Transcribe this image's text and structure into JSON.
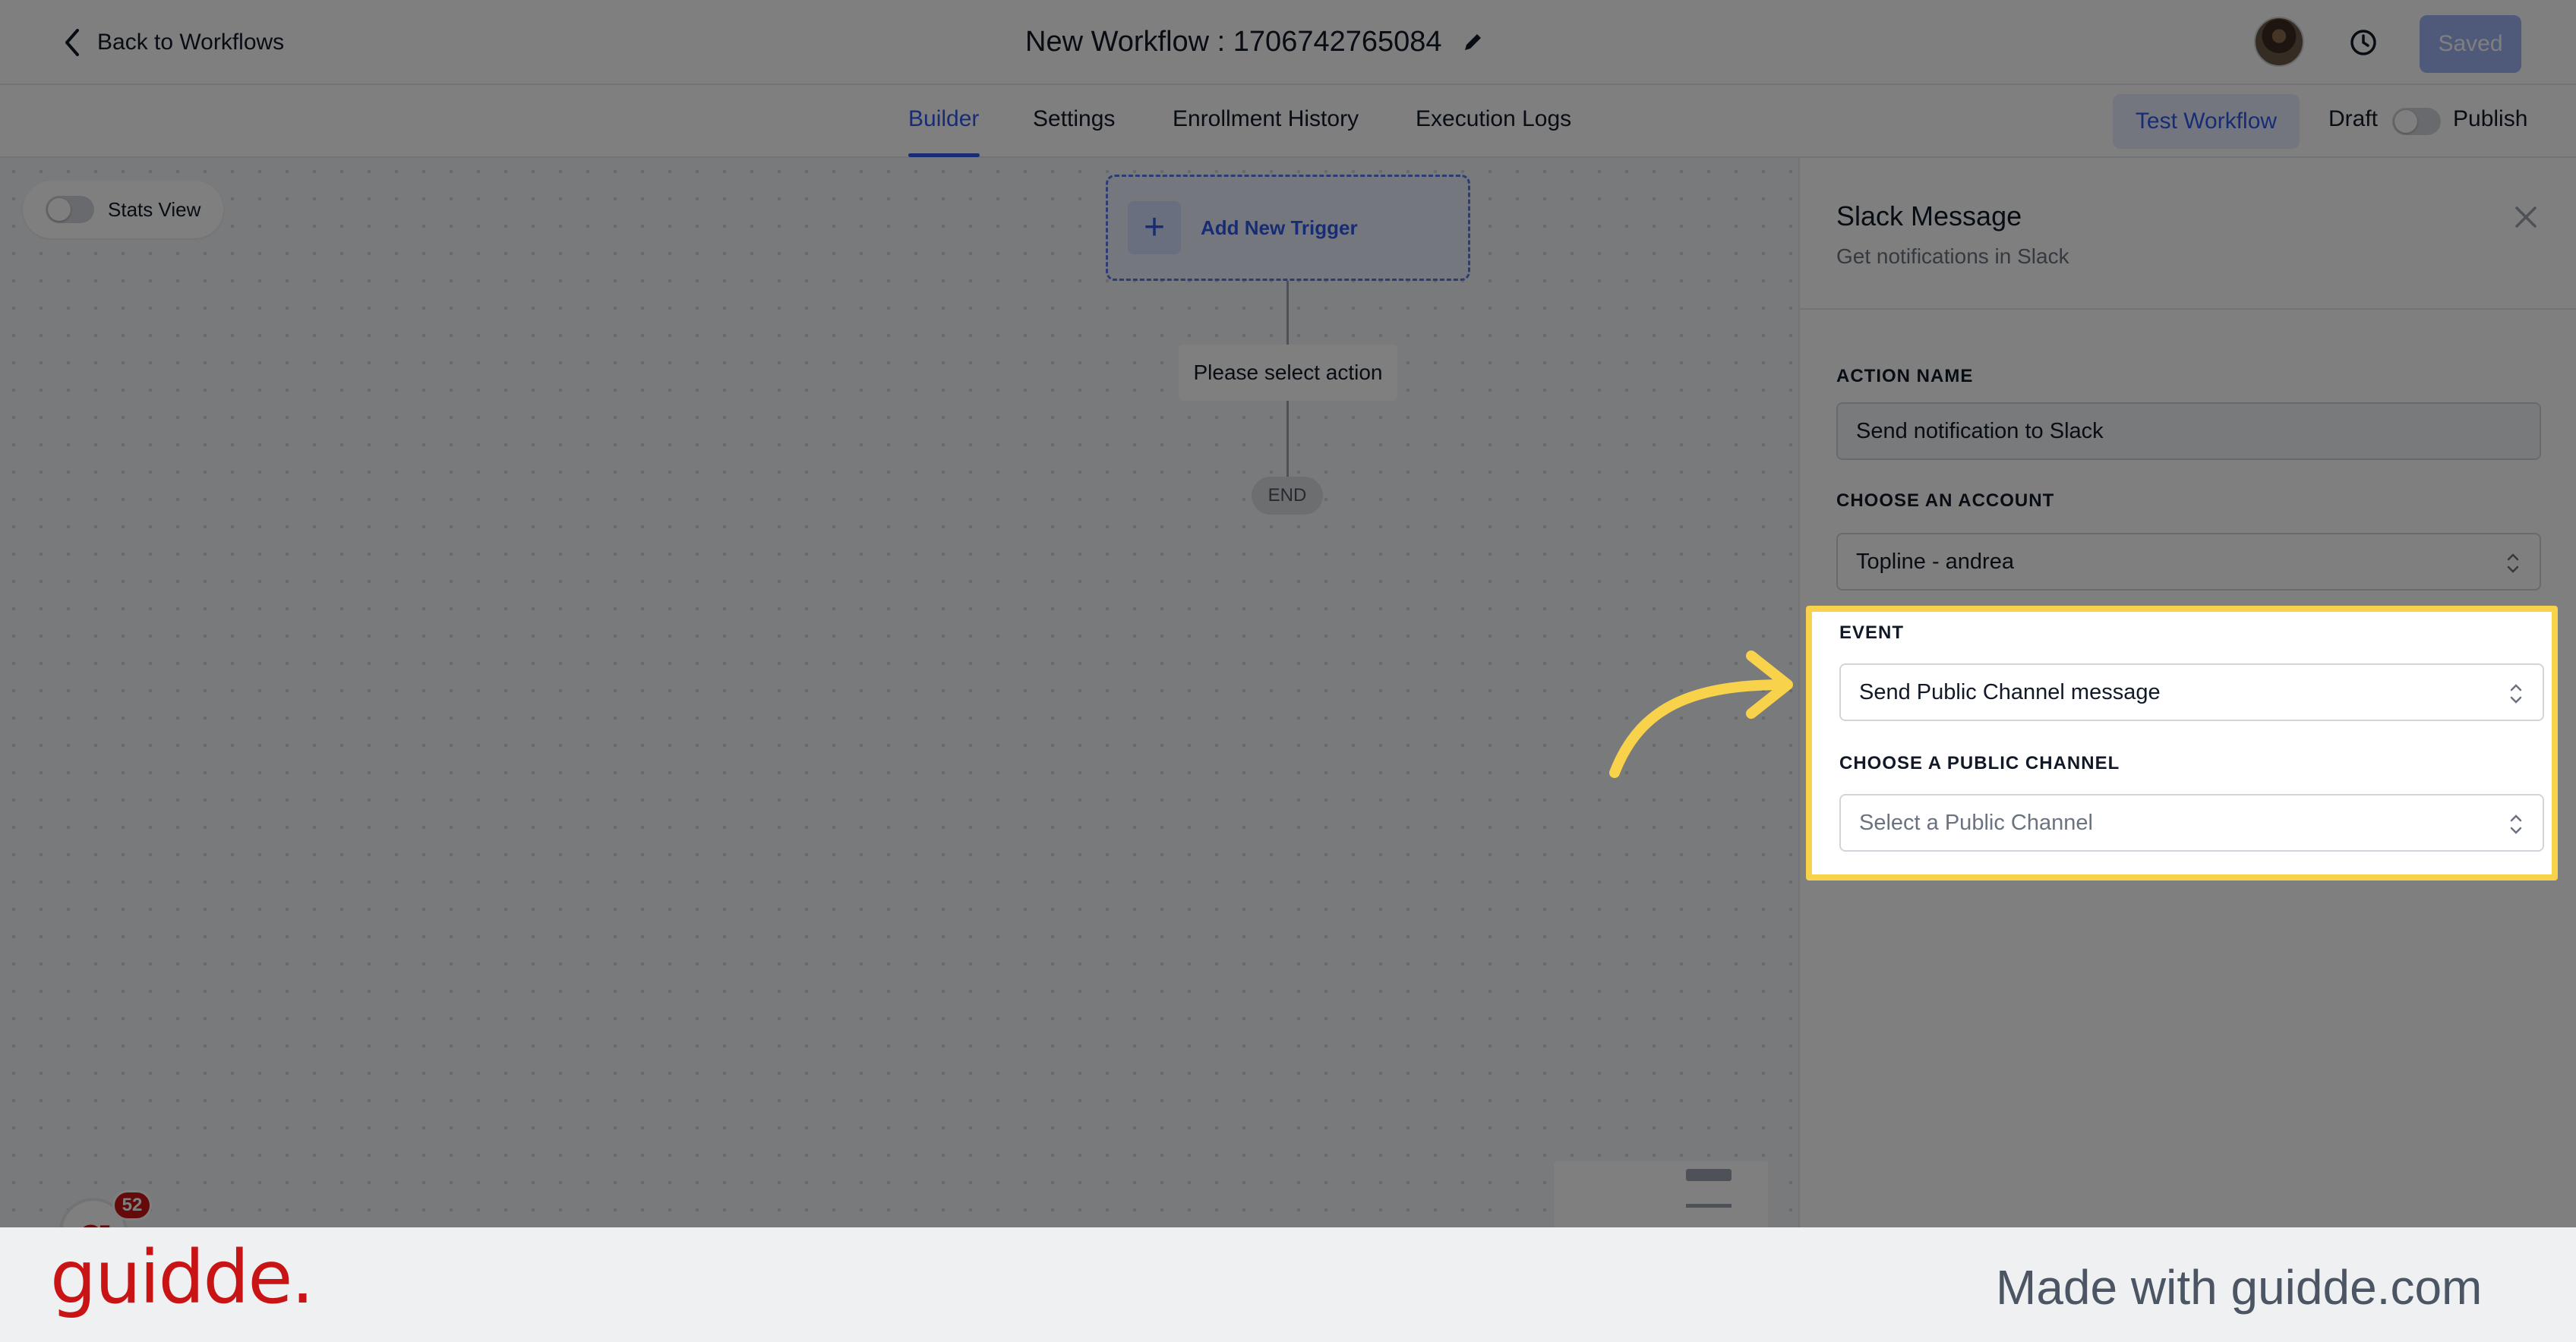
{
  "header": {
    "back_label": "Back to Workflows",
    "workflow_title": "New Workflow : 1706742765084",
    "saved_label": "Saved"
  },
  "tabs": [
    {
      "label": "Builder",
      "active": true
    },
    {
      "label": "Settings",
      "active": false
    },
    {
      "label": "Enrollment History",
      "active": false
    },
    {
      "label": "Execution Logs",
      "active": false
    }
  ],
  "toolbar": {
    "test_label": "Test Workflow",
    "draft_label": "Draft",
    "publish_label": "Publish"
  },
  "canvas": {
    "stats_label": "Stats View",
    "trigger_label": "Add New Trigger",
    "action_label": "Please select action",
    "end_label": "END",
    "notification_count": "52"
  },
  "panel": {
    "title": "Slack Message",
    "subtitle": "Get notifications in Slack",
    "fields": {
      "action_name": {
        "label": "ACTION NAME",
        "value": "Send notification to Slack"
      },
      "account": {
        "label": "CHOOSE AN ACCOUNT",
        "value": "Topline - andrea"
      },
      "event": {
        "label": "EVENT",
        "value": "Send Public Channel message"
      },
      "channel": {
        "label": "CHOOSE A PUBLIC CHANNEL",
        "placeholder": "Select a Public Channel"
      }
    }
  },
  "footer": {
    "brand": "guidde.",
    "made_with": "Made with guidde.com"
  },
  "colors": {
    "accent": "#3058e8",
    "highlight": "#f8d24a",
    "brand": "#c81414"
  }
}
